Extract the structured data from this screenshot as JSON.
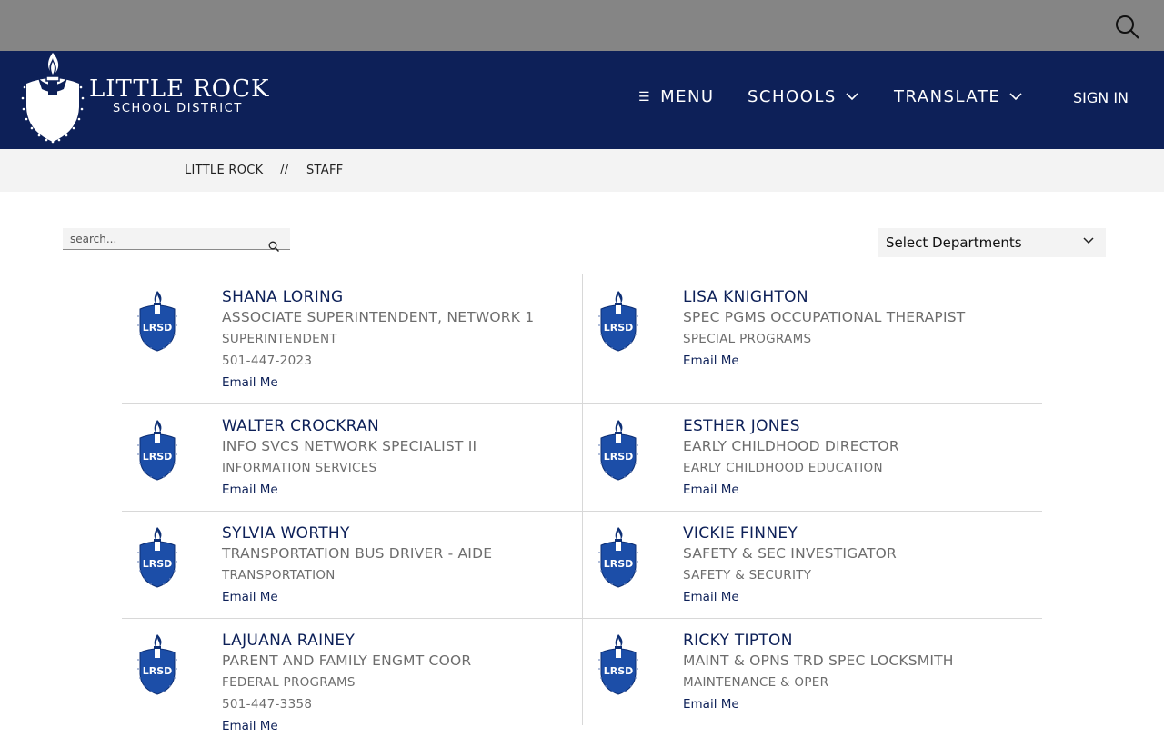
{
  "header": {
    "logo_name": "LITTLE ROCK",
    "logo_sub": "SCHOOL DISTRICT",
    "nav": {
      "menu": "MENU",
      "schools": "SCHOOLS",
      "translate": "TRANSLATE",
      "sign_in": "SIGN IN"
    },
    "search_icon": "search-icon"
  },
  "breadcrumb": {
    "home": "LITTLE ROCK",
    "separator": "//",
    "current": "STAFF"
  },
  "filters": {
    "search_placeholder": "search...",
    "department_select": "Select Departments"
  },
  "avatar_text": "LRSD",
  "staff": [
    {
      "name": "SHANA LORING",
      "title": "ASSOCIATE SUPERINTENDENT, NETWORK 1",
      "department": "SUPERINTENDENT",
      "phone": "501-447-2023",
      "email_label": "Email Me"
    },
    {
      "name": "LISA KNIGHTON",
      "title": "SPEC PGMS OCCUPATIONAL THERAPIST",
      "department": "SPECIAL PROGRAMS",
      "phone": "",
      "email_label": "Email Me"
    },
    {
      "name": "WALTER CROCKRAN",
      "title": "INFO SVCS NETWORK SPECIALIST II",
      "department": "INFORMATION SERVICES",
      "phone": "",
      "email_label": "Email Me"
    },
    {
      "name": "ESTHER JONES",
      "title": "EARLY CHILDHOOD DIRECTOR",
      "department": "EARLY CHILDHOOD EDUCATION",
      "phone": "",
      "email_label": "Email Me"
    },
    {
      "name": "SYLVIA WORTHY",
      "title": "TRANSPORTATION BUS DRIVER - AIDE",
      "department": "TRANSPORTATION",
      "phone": "",
      "email_label": "Email Me"
    },
    {
      "name": "VICKIE FINNEY",
      "title": "SAFETY & SEC INVESTIGATOR",
      "department": "SAFETY & SECURITY",
      "phone": "",
      "email_label": "Email Me"
    },
    {
      "name": "LAJUANA RAINEY",
      "title": "PARENT AND FAMILY ENGMT COOR",
      "department": "FEDERAL PROGRAMS",
      "phone": "501-447-3358",
      "email_label": "Email Me"
    },
    {
      "name": "RICKY TIPTON",
      "title": "MAINT & OPNS TRD SPEC LOCKSMITH",
      "department": "MAINTENANCE & OPER",
      "phone": "",
      "email_label": "Email Me"
    }
  ],
  "colors": {
    "header_bg": "#0d2058",
    "topbar_bg": "#858585",
    "accent": "#0d2058",
    "crumb_bg": "#f3f3f3"
  }
}
